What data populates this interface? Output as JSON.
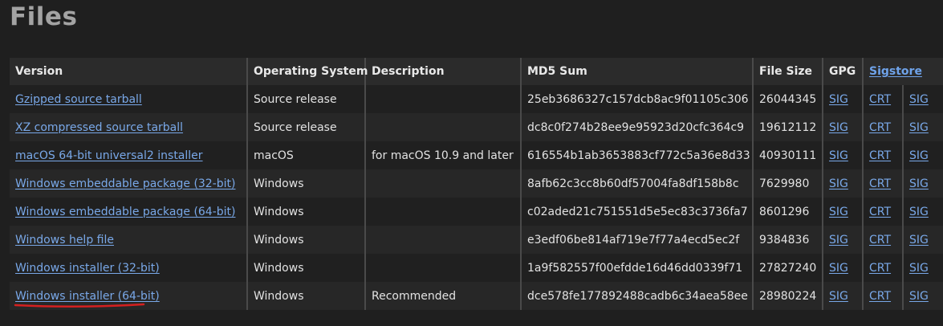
{
  "title": "Files",
  "headers": {
    "version": "Version",
    "os": "Operating System",
    "description": "Description",
    "md5": "MD5 Sum",
    "size": "File Size",
    "gpg": "GPG",
    "sigstore": "Sigstore"
  },
  "rows": [
    {
      "version": "Gzipped source tarball",
      "os": "Source release",
      "description": "",
      "md5": "25eb3686327c157dcb8ac9f01105c306",
      "size": "26044345",
      "gpg": "SIG",
      "crt": "CRT",
      "sig": "SIG"
    },
    {
      "version": "XZ compressed source tarball",
      "os": "Source release",
      "description": "",
      "md5": "dc8c0f274b28ee9e95923d20cfc364c9",
      "size": "19612112",
      "gpg": "SIG",
      "crt": "CRT",
      "sig": "SIG"
    },
    {
      "version": "macOS 64-bit universal2 installer",
      "os": "macOS",
      "description": "for macOS 10.9 and later",
      "md5": "616554b1ab3653883cf772c5a36e8d33",
      "size": "40930111",
      "gpg": "SIG",
      "crt": "CRT",
      "sig": "SIG"
    },
    {
      "version": "Windows embeddable package (32-bit)",
      "os": "Windows",
      "description": "",
      "md5": "8afb62c3cc8b60df57004fa8df158b8c",
      "size": "7629980",
      "gpg": "SIG",
      "crt": "CRT",
      "sig": "SIG"
    },
    {
      "version": "Windows embeddable package (64-bit)",
      "os": "Windows",
      "description": "",
      "md5": "c02aded21c751551d5e5ec83c3736fa7",
      "size": "8601296",
      "gpg": "SIG",
      "crt": "CRT",
      "sig": "SIG"
    },
    {
      "version": "Windows help file",
      "os": "Windows",
      "description": "",
      "md5": "e3edf06be814af719e7f77a4ecd5ec2f",
      "size": "9384836",
      "gpg": "SIG",
      "crt": "CRT",
      "sig": "SIG"
    },
    {
      "version": "Windows installer (32-bit)",
      "os": "Windows",
      "description": "",
      "md5": "1a9f582557f00efdde16d46dd0339f71",
      "size": "27827240",
      "gpg": "SIG",
      "crt": "CRT",
      "sig": "SIG"
    },
    {
      "version": "Windows installer (64-bit)",
      "os": "Windows",
      "description": "Recommended",
      "md5": "dce578fe177892488cadb6c34aea58ee",
      "size": "28980224",
      "gpg": "SIG",
      "crt": "CRT",
      "sig": "SIG"
    }
  ],
  "colors": {
    "link": "#79a8e8",
    "annotation": "#d42020"
  }
}
